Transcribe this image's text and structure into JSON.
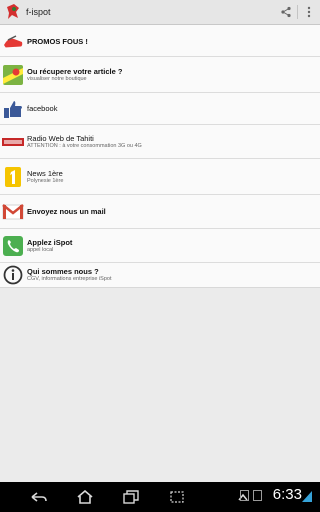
{
  "app": {
    "title": "f-ispot"
  },
  "items": [
    {
      "title": "PROMOS FOUS !",
      "subtitle": "",
      "icon": "promo-shoe-icon"
    },
    {
      "title": "Ou récupere votre article ?",
      "subtitle": "visualiser notre boutique",
      "icon": "maps-icon"
    },
    {
      "title": "facebook",
      "subtitle": "",
      "icon": "thumbs-up-icon"
    },
    {
      "title": "Radio Web de Tahiti",
      "subtitle": "ATTENTION : à votre consommation 3G ou 4G",
      "icon": "radio-logo-icon"
    },
    {
      "title": "News 1ère",
      "subtitle": "Polynesie 1ère",
      "icon": "news-1ere-icon"
    },
    {
      "title": "Envoyez nous un mail",
      "subtitle": "",
      "icon": "gmail-icon"
    },
    {
      "title": "Applez iSpot",
      "subtitle": "appel local",
      "icon": "phone-icon"
    },
    {
      "title": "Qui sommes nous ?",
      "subtitle": "CGV, informations entreprise iSpot",
      "icon": "info-icon"
    }
  ],
  "status": {
    "time": "6:33"
  },
  "colors": {
    "accent": "#36a3d9",
    "gmail": "#d14836",
    "phone": "#4caf50",
    "news": "#f5c400"
  }
}
